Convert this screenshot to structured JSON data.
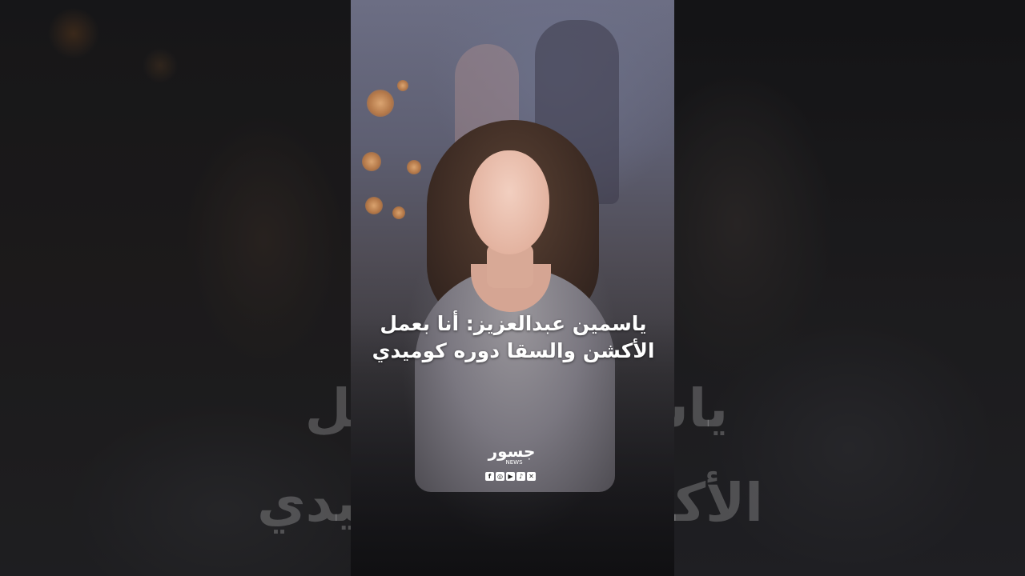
{
  "headline": {
    "line1": "ياسمين عبدالعزيز: أنا بعمل",
    "line2": "الأكشن والسقا دوره كوميدي"
  },
  "background_text": {
    "line1": "ياسمين أنا بعمل",
    "line2": "الأكشن و ه كوميدي"
  },
  "logo": {
    "wordmark": "جسور",
    "subtitle": "NEWS"
  },
  "social_icons": [
    "facebook-icon",
    "instagram-icon",
    "youtube-icon",
    "tiktok-icon",
    "x-icon"
  ],
  "colors": {
    "text": "#ffffff",
    "bokeh": "#f0b070"
  }
}
